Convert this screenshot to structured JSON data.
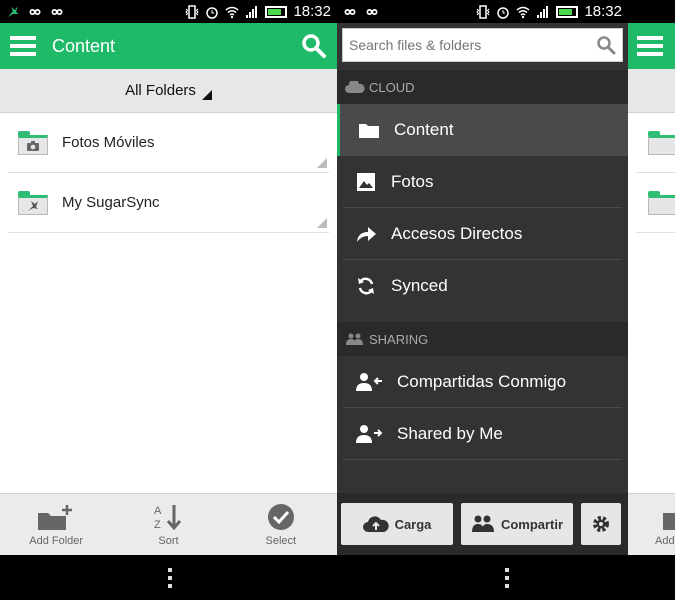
{
  "status_bar": {
    "time": "18:32"
  },
  "left_screen": {
    "title": "Content",
    "folder_selector": "All Folders",
    "items": [
      {
        "label": "Fotos Móviles",
        "icon": "camera-icon"
      },
      {
        "label": "My SugarSync",
        "icon": "sugarsync-logo-icon"
      }
    ],
    "bottom_actions": [
      {
        "label": "Add Folder",
        "icon": "add-folder-icon"
      },
      {
        "label": "Sort",
        "icon": "sort-az-icon"
      },
      {
        "label": "Select",
        "icon": "check-circle-icon"
      }
    ]
  },
  "drawer": {
    "search_placeholder": "Search files & folders",
    "cloud_header": "CLOUD",
    "cloud_items": [
      {
        "label": "Content",
        "icon": "folder-icon",
        "active": true
      },
      {
        "label": "Fotos",
        "icon": "image-icon"
      },
      {
        "label": "Accesos Directos",
        "icon": "share-arrow-icon"
      },
      {
        "label": "Synced",
        "icon": "sync-icon"
      }
    ],
    "sharing_header": "SHARING",
    "sharing_items": [
      {
        "label": "Compartidas Conmigo",
        "icon": "user-incoming-icon"
      },
      {
        "label": "Shared by Me",
        "icon": "user-outgoing-icon"
      }
    ],
    "bottom_buttons": {
      "upload": "Carga",
      "share": "Compartir"
    }
  },
  "right_screen": {
    "partial_label": "Add"
  },
  "colors": {
    "accent": "#1fba68",
    "drawer_bg": "#333333"
  }
}
